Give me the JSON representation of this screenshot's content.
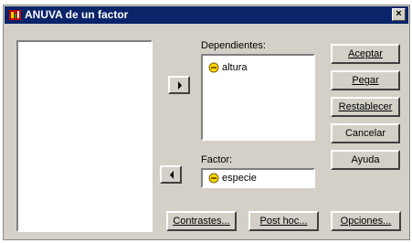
{
  "window": {
    "title": "ANUVA de un factor"
  },
  "labels": {
    "dependientes": "Dependientes:",
    "factor": "Factor:"
  },
  "dependientes": {
    "items": [
      {
        "label": "altura"
      }
    ]
  },
  "factor": {
    "value": "especie"
  },
  "buttons": {
    "aceptar": "Aceptar",
    "pegar": "Pegar",
    "restablecer": "Restablecer",
    "cancelar": "Cancelar",
    "ayuda": "Ayuda",
    "contrastes": "Contrastes...",
    "post_hoc": "Post hoc...",
    "opciones": "Opciones..."
  },
  "icons": {
    "window": "spss-window-icon",
    "close": "close-icon",
    "move_right": "arrow-right-icon",
    "move_left": "arrow-left-icon",
    "variable": "scale-variable-icon"
  },
  "colors": {
    "titlebar": "#0a246a",
    "face": "#d4d0c8"
  }
}
